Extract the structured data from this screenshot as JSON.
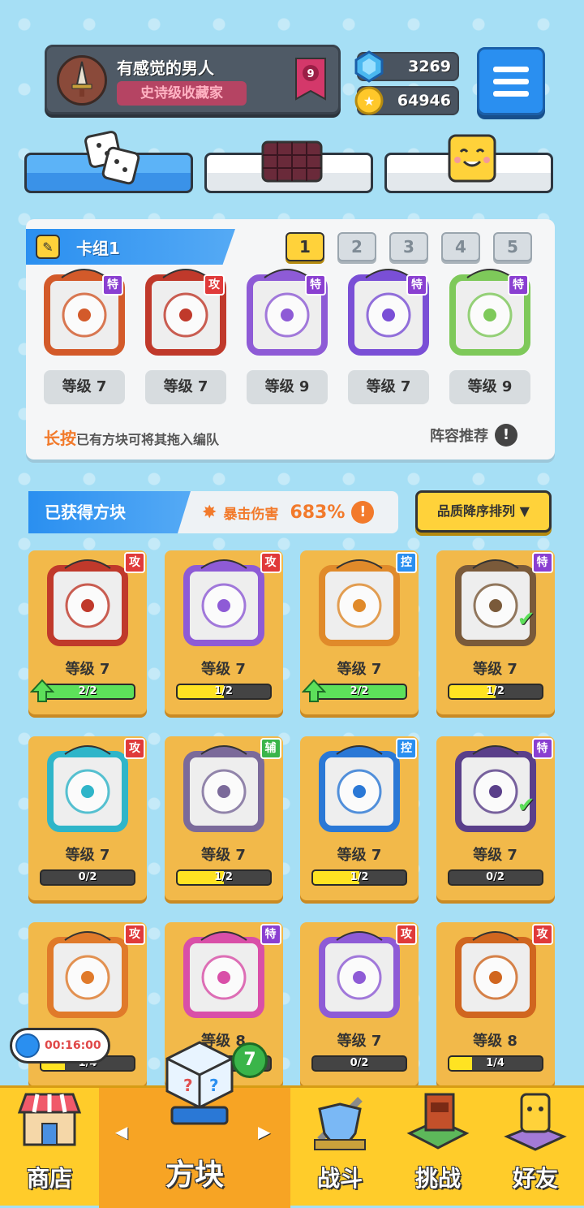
{
  "profile": {
    "name": "有感觉的男人",
    "title": "史诗级收藏家",
    "rank": "9"
  },
  "resources": {
    "gems": "3269",
    "coins": "64946"
  },
  "deck": {
    "title": "卡组1",
    "numbers": [
      "1",
      "2",
      "3",
      "4",
      "5"
    ],
    "selected": "1",
    "cards": [
      {
        "badge": "特",
        "badge_color": "#8a3fd1",
        "level": "等级 7"
      },
      {
        "badge": "攻",
        "badge_color": "#e03a3a",
        "level": "等级 7"
      },
      {
        "badge": "特",
        "badge_color": "#8a3fd1",
        "level": "等级 9"
      },
      {
        "badge": "特",
        "badge_color": "#8a3fd1",
        "level": "等级 7"
      },
      {
        "badge": "特",
        "badge_color": "#8a3fd1",
        "level": "等级 9"
      }
    ],
    "hint_bold": "长按",
    "hint_rest": "已有方块可将其拖入编队",
    "recommend": "阵容推荐",
    "recommend_icon": "!"
  },
  "owned": {
    "title": "已获得方块",
    "crit_label": "暴击伤害",
    "crit_value": "683%",
    "crit_icon": "!",
    "sort_label": "品质降序排列 ▼"
  },
  "cards": [
    {
      "badge": "攻",
      "badge_color": "#e03a3a",
      "frame": "#c0392b",
      "level": "等级 7",
      "progress": "2/2",
      "fill": 1.0,
      "upgrade": true,
      "equipped": false
    },
    {
      "badge": "攻",
      "badge_color": "#e03a3a",
      "frame": "#8e5bd6",
      "level": "等级 7",
      "progress": "1/2",
      "fill": 0.5,
      "upgrade": false,
      "equipped": false
    },
    {
      "badge": "控",
      "badge_color": "#2a8ff0",
      "frame": "#e08a2a",
      "level": "等级 7",
      "progress": "2/2",
      "fill": 1.0,
      "upgrade": true,
      "equipped": false
    },
    {
      "badge": "特",
      "badge_color": "#8a3fd1",
      "frame": "#7a5a3a",
      "level": "等级 7",
      "progress": "1/2",
      "fill": 0.5,
      "upgrade": false,
      "equipped": true
    },
    {
      "badge": "攻",
      "badge_color": "#e03a3a",
      "frame": "#2fb5c9",
      "level": "等级 7",
      "progress": "0/2",
      "fill": 0.0,
      "upgrade": false,
      "equipped": false
    },
    {
      "badge": "辅",
      "badge_color": "#3ab54a",
      "frame": "#7b6a9a",
      "level": "等级 7",
      "progress": "1/2",
      "fill": 0.5,
      "upgrade": false,
      "equipped": false
    },
    {
      "badge": "控",
      "badge_color": "#2a8ff0",
      "frame": "#2a78d6",
      "level": "等级 7",
      "progress": "1/2",
      "fill": 0.5,
      "upgrade": false,
      "equipped": false
    },
    {
      "badge": "特",
      "badge_color": "#8a3fd1",
      "frame": "#5a3f8a",
      "level": "等级 7",
      "progress": "0/2",
      "fill": 0.0,
      "upgrade": false,
      "equipped": true
    },
    {
      "badge": "攻",
      "badge_color": "#e03a3a",
      "frame": "#e07a2a",
      "level": "",
      "progress": "1/4",
      "fill": 0.25,
      "upgrade": false,
      "equipped": false
    },
    {
      "badge": "特",
      "badge_color": "#8a3fd1",
      "frame": "#d94fa8",
      "level": "等级 8",
      "progress": "",
      "fill": 0.0,
      "upgrade": false,
      "equipped": false
    },
    {
      "badge": "攻",
      "badge_color": "#e03a3a",
      "frame": "#8e5bd6",
      "level": "等级 7",
      "progress": "0/2",
      "fill": 0.0,
      "upgrade": false,
      "equipped": false
    },
    {
      "badge": "攻",
      "badge_color": "#e03a3a",
      "frame": "#d0661f",
      "level": "等级 8",
      "progress": "1/4",
      "fill": 0.25,
      "upgrade": false,
      "equipped": false
    }
  ],
  "timer": "00:16:00",
  "new_count": "7",
  "nav": [
    {
      "label": "商店",
      "icon": "shop-icon"
    },
    {
      "label": "方块",
      "icon": "block-icon"
    },
    {
      "label": "战斗",
      "icon": "battle-icon"
    },
    {
      "label": "挑战",
      "icon": "challenge-icon"
    },
    {
      "label": "好友",
      "icon": "friends-icon"
    }
  ],
  "tabs": [
    {
      "icon": "dice-icon"
    },
    {
      "icon": "grid-board-icon"
    },
    {
      "icon": "smiley-block-icon"
    }
  ],
  "colors": {
    "accent": "#2a8ff0",
    "card": "#f2b94a",
    "nav": "#ffcc2a"
  }
}
